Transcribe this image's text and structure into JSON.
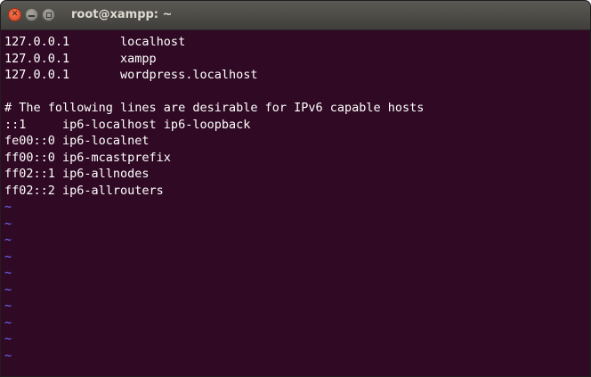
{
  "window": {
    "title": "root@xampp: ~",
    "controls": {
      "close_glyph": "✕"
    }
  },
  "terminal": {
    "lines": [
      "127.0.0.1       localhost",
      "127.0.0.1       xampp",
      "127.0.0.1       wordpress.localhost",
      "",
      "# The following lines are desirable for IPv6 capable hosts",
      "::1     ip6-localhost ip6-loopback",
      "fe00::0 ip6-localnet",
      "ff00::0 ip6-mcastprefix",
      "ff02::1 ip6-allnodes",
      "ff02::2 ip6-allrouters"
    ],
    "tilde_lines": [
      "~",
      "~",
      "~",
      "~",
      "~",
      "~",
      "~",
      "~",
      "~",
      "~"
    ]
  },
  "colors": {
    "terminal_background": "#300a24",
    "text": "#ffffff",
    "tilde": "#6d6dff",
    "close_button": "#e95420"
  }
}
